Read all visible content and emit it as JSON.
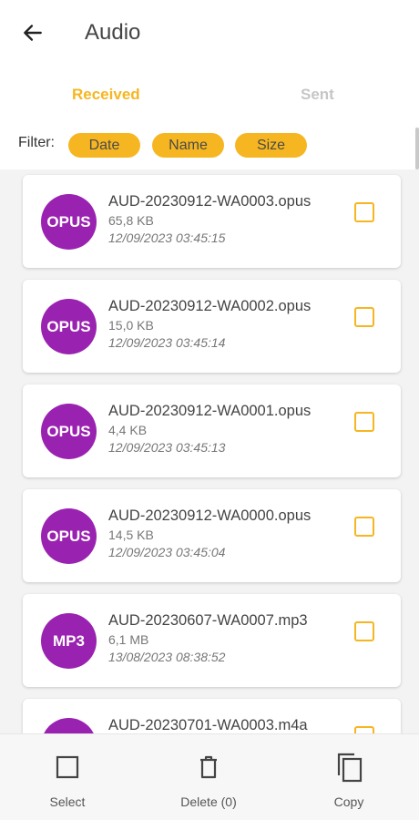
{
  "header": {
    "title": "Audio",
    "back_icon": "arrow-left-icon"
  },
  "tabs": [
    {
      "label": "Received",
      "active": true
    },
    {
      "label": "Sent",
      "active": false
    }
  ],
  "filter": {
    "label": "Filter:",
    "chips": [
      "Date",
      "Name",
      "Size"
    ]
  },
  "colors": {
    "accent": "#f6b621",
    "badge": "#9a22b0",
    "inactive_tab": "#c6c6c6"
  },
  "files": [
    {
      "type": "OPUS",
      "name": "AUD-20230912-WA0003.opus",
      "size": "65,8 KB",
      "date": "12/09/2023 03:45:15"
    },
    {
      "type": "OPUS",
      "name": "AUD-20230912-WA0002.opus",
      "size": "15,0 KB",
      "date": "12/09/2023 03:45:14"
    },
    {
      "type": "OPUS",
      "name": "AUD-20230912-WA0001.opus",
      "size": "4,4 KB",
      "date": "12/09/2023 03:45:13"
    },
    {
      "type": "OPUS",
      "name": "AUD-20230912-WA0000.opus",
      "size": "14,5 KB",
      "date": "12/09/2023 03:45:04"
    },
    {
      "type": "MP3",
      "name": "AUD-20230607-WA0007.mp3",
      "size": "6,1 MB",
      "date": "13/08/2023 08:38:52"
    },
    {
      "type": "",
      "name": "AUD-20230701-WA0003.m4a",
      "size": "",
      "date": ""
    }
  ],
  "bottom_bar": {
    "select_label": "Select",
    "delete_label": "Delete (0)",
    "copy_label": "Copy"
  }
}
